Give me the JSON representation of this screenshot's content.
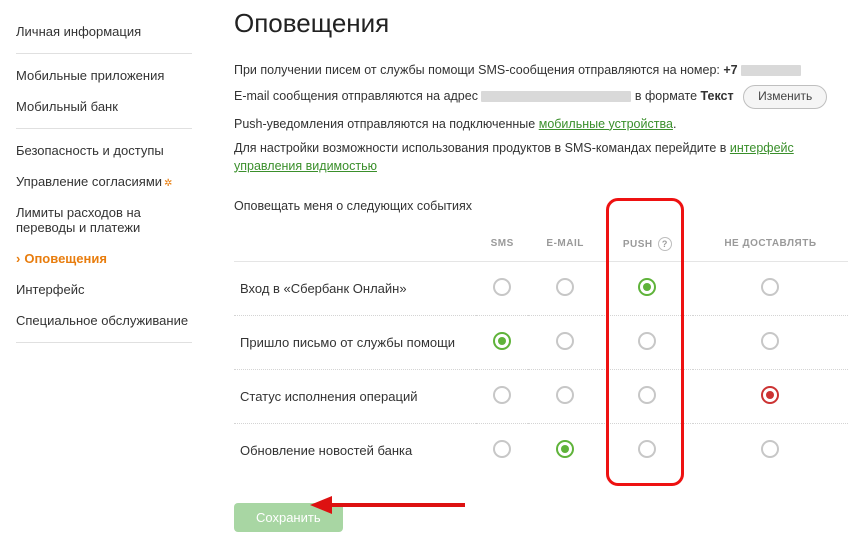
{
  "sidebar": {
    "items": [
      {
        "label": "Личная информация"
      },
      {
        "label": "Мобильные приложения"
      },
      {
        "label": "Мобильный банк"
      },
      {
        "label": "Безопасность и доступы"
      },
      {
        "label": "Управление согласиями",
        "star": true
      },
      {
        "label": "Лимиты расходов на переводы и платежи"
      },
      {
        "label": "Оповещения",
        "active": true
      },
      {
        "label": "Интерфейс"
      },
      {
        "label": "Специальное обслуживание"
      }
    ]
  },
  "header": {
    "title": "Оповещения"
  },
  "info": {
    "line1_prefix": "При получении писем от службы помощи SMS-сообщения отправляются на номер: ",
    "phone_prefix": "+7",
    "line2_prefix": "E-mail сообщения отправляются на адрес ",
    "line2_mid": " в формате ",
    "format": "Текст",
    "change_btn": "Изменить",
    "line3_prefix": "Push-уведомления отправляются на подключенные ",
    "line3_link": "мобильные устройства",
    "line4_prefix": "Для настройки возможности использования продуктов в SMS-командах перейдите в ",
    "line4_link": "интерфейс управления видимостью"
  },
  "section_label": "Оповещать меня о следующих событиях",
  "table": {
    "headers": {
      "sms": "SMS",
      "email": "E-MAIL",
      "push": "PUSH",
      "none": "НЕ ДОСТАВЛЯТЬ"
    },
    "rows": [
      {
        "label": "Вход в «Сбербанк Онлайн»",
        "selected": "push",
        "selColor": "green"
      },
      {
        "label": "Пришло письмо от службы помощи",
        "selected": "sms",
        "selColor": "green"
      },
      {
        "label": "Статус исполнения операций",
        "selected": "none",
        "selColor": "red"
      },
      {
        "label": "Обновление новостей банка",
        "selected": "email",
        "selColor": "green"
      }
    ]
  },
  "save_btn": "Сохранить"
}
